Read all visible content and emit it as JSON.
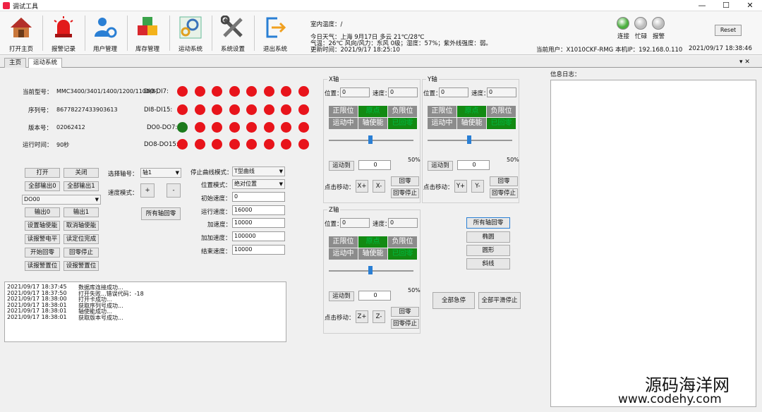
{
  "window": {
    "title": "调试工具",
    "controls": [
      "—",
      "☐",
      "✕"
    ]
  },
  "toolbar": {
    "buttons": [
      {
        "label": "打开主页",
        "icon": "home-icon"
      },
      {
        "label": "报警记录",
        "icon": "alarm-light-icon"
      },
      {
        "label": "用户管理",
        "icon": "users-gear-icon"
      },
      {
        "label": "库存管理",
        "icon": "boxes-icon"
      },
      {
        "label": "运动系统",
        "icon": "motion-gear-icon"
      },
      {
        "label": "系统设置",
        "icon": "tools-icon"
      },
      {
        "label": "退出系统",
        "icon": "exit-icon"
      }
    ],
    "indoor_temp": "室内温度：/",
    "weather": "今日天气：上海 9月17日 多云 21℃/28℃",
    "weather2": "气温：26℃ 风向/风力：东风 0级；湿度：57%；紫外线强度：弱。",
    "update_time": "更新时间：2021/9/17 18:25:10",
    "leds": [
      {
        "label": "连接",
        "color": "#4caf3f"
      },
      {
        "label": "忙碌",
        "color": "#bdbdbd"
      },
      {
        "label": "报警",
        "color": "#bdbdbd"
      }
    ],
    "reset_label": "Reset",
    "current_user": "当前用户：X1010CKF-RMG",
    "local_ip": "本机IP：192.168.0.110",
    "datetime": "2021/09/17 18:38:46"
  },
  "tabs": [
    {
      "label": "主页"
    },
    {
      "label": "运动系统"
    }
  ],
  "tab_dropdown": "▾ ✕",
  "device": {
    "model_label": "当前型号：",
    "model_value": "MMC3400/3401/1400/1200/1100(B)",
    "serial_label": "序列号：",
    "serial_value": "86778227433903613",
    "version_label": "版本号：",
    "version_value": "02062412",
    "runtime_label": "运行时间：",
    "runtime_value": "90秒"
  },
  "io": {
    "rows": [
      {
        "label": "DI0-DI7:",
        "states": [
          "r",
          "r",
          "r",
          "r",
          "r",
          "r",
          "r",
          "r"
        ]
      },
      {
        "label": "DI8-DI15:",
        "states": [
          "r",
          "r",
          "r",
          "r",
          "r",
          "r",
          "r",
          "r"
        ]
      },
      {
        "label": "DO0-DO7:",
        "states": [
          "g",
          "r",
          "r",
          "r",
          "r",
          "r",
          "r",
          "r"
        ]
      },
      {
        "label": "DO8-DO15:",
        "states": [
          "r",
          "r",
          "r",
          "r",
          "r",
          "r",
          "r",
          "r"
        ]
      }
    ]
  },
  "controls": {
    "open": "打开",
    "close": "关闭",
    "all_out0": "全部输出0",
    "all_out1": "全部输出1",
    "do_select": "DO00",
    "out0": "输出0",
    "out1": "输出1",
    "set_enable": "设置轴使能",
    "cancel_enable": "取消轴使能",
    "read_alarm": "读报警电平",
    "read_position": "读定位完成",
    "start_home": "开始回零",
    "stop_home": "回零停止",
    "read_alarm_pos": "读报警置位",
    "set_alarm_pos": "设报警置位",
    "axis_label": "选择轴号：",
    "axis_value": "轴1",
    "speed_mode": "速度模式：",
    "plus": "+",
    "minus": "-",
    "all_home": "所有轴回零"
  },
  "params": {
    "curve_label": "停止曲线模式：",
    "curve_value": "T型曲线",
    "pos_mode_label": "位置模式：",
    "pos_mode_value": "绝对位置",
    "init_speed_label": "初始速度：",
    "init_speed_value": "0",
    "run_speed_label": "运行速度：",
    "run_speed_value": "16000",
    "accel_label": "加速度：",
    "accel_value": "10000",
    "jerk_label": "加加速度：",
    "jerk_value": "100000",
    "end_speed_label": "结束速度：",
    "end_speed_value": "10000"
  },
  "log": [
    {
      "time": "2021/09/17 18:37:45",
      "msg": "数据库连接成功..."
    },
    {
      "time": "2021/09/17 18:37:50",
      "msg": "打开失败...错误代码：-18"
    },
    {
      "time": "2021/09/17 18:38:00",
      "msg": "打开卡成功..."
    },
    {
      "time": "2021/09/17 18:38:01",
      "msg": "获取序列号成功..."
    },
    {
      "time": "2021/09/17 18:38:01",
      "msg": "轴使能成功..."
    },
    {
      "time": "2021/09/17 18:38:01",
      "msg": "获取版本号成功..."
    }
  ],
  "axes": [
    {
      "title": "X轴",
      "pos_label": "位置：",
      "pos_value": "0",
      "speed_label": "速度：",
      "speed_value": "0",
      "statuses": [
        {
          "text": "正限位",
          "state": "gray"
        },
        {
          "text": "原点",
          "state": "green"
        },
        {
          "text": "负限位",
          "state": "gray"
        },
        {
          "text": "运动中",
          "state": "gray"
        },
        {
          "text": "轴使能",
          "state": "gray"
        },
        {
          "text": "已回零",
          "state": "green"
        }
      ],
      "slider": 0.5,
      "pct": "50%",
      "move_to": "运动到",
      "move_value": "0",
      "jog_label": "点击移动：",
      "jog_plus": "X+",
      "jog_minus": "X-",
      "home": "回零",
      "home_stop": "回零停止"
    },
    {
      "title": "Y轴",
      "pos_label": "位置：",
      "pos_value": "0",
      "speed_label": "速度：",
      "speed_value": "0",
      "statuses": [
        {
          "text": "正限位",
          "state": "gray"
        },
        {
          "text": "原点",
          "state": "green"
        },
        {
          "text": "负限位",
          "state": "gray"
        },
        {
          "text": "运动中",
          "state": "gray"
        },
        {
          "text": "轴使能",
          "state": "gray"
        },
        {
          "text": "已回零",
          "state": "green"
        }
      ],
      "slider": 0.5,
      "pct": "50%",
      "move_to": "运动到",
      "move_value": "0",
      "jog_label": "点击移动：",
      "jog_plus": "Y+",
      "jog_minus": "Y-",
      "home": "回零",
      "home_stop": "回零停止"
    },
    {
      "title": "Z轴",
      "pos_label": "位置：",
      "pos_value": "0",
      "speed_label": "速度：",
      "speed_value": "0",
      "statuses": [
        {
          "text": "正限位",
          "state": "gray"
        },
        {
          "text": "原点",
          "state": "green"
        },
        {
          "text": "负限位",
          "state": "gray"
        },
        {
          "text": "运动中",
          "state": "gray"
        },
        {
          "text": "轴使能",
          "state": "gray"
        },
        {
          "text": "已回零",
          "state": "green"
        }
      ],
      "slider": 0.5,
      "pct": "50%",
      "move_to": "运动到",
      "move_value": "0",
      "jog_label": "点击移动：",
      "jog_plus": "Z+",
      "jog_minus": "Z-",
      "home": "回零",
      "home_stop": "回零停止"
    }
  ],
  "motion": {
    "all_home": "所有轴回零",
    "ellipse": "椭圆",
    "circle": "圆形",
    "line": "斜线",
    "estop": "全部急停",
    "smooth_stop": "全部平滑停止"
  },
  "info_log_label": "信息日志：",
  "watermark": {
    "line1": "源码海洋网",
    "line2": "www.codehy.com"
  }
}
